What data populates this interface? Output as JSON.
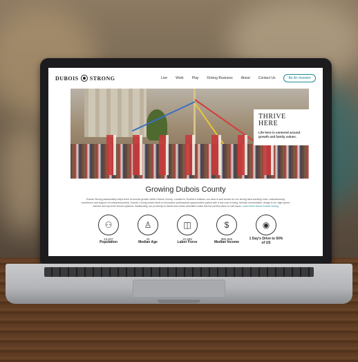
{
  "site": {
    "logo_text_left": "DUBOIS",
    "logo_text_right": "STRONG",
    "nav": [
      "Live",
      "Work",
      "Play",
      "Driving Business",
      "About",
      "Contact Us"
    ],
    "cta": "Be An Investor"
  },
  "hero": {
    "title": "THRIVE HERE",
    "subtitle": "Life here is centered around growth and family values."
  },
  "section": {
    "title": "Growing Dubois County",
    "body": "Dubois Strong passionately helps drive economic growth within Dubois County. Located in Southern Indiana, our area is well known for our strong hard-working roots, manufacturing excellence and support of entrepreneurship. Dubois County prides itself on innovative professional opportunities paired with a low cost of living, friendly communities, things to do, high speed internet and top-level school systems. Additionally, our proximity to transit and urban amenities make this the perfect place to call home.",
    "link": "Learn More About Dubois Strong"
  },
  "stats": [
    {
      "value": "43,637",
      "label": "Population",
      "icon": "people-icon"
    },
    {
      "value": "40",
      "label": "Median Age",
      "icon": "group-icon"
    },
    {
      "value": "22,585",
      "label": "Labor Force",
      "icon": "toolbox-icon"
    },
    {
      "value": "$50,666",
      "label": "Median Income",
      "icon": "money-bag-icon"
    },
    {
      "value": "",
      "label": "1 Day's Drive to 50% of US",
      "icon": "map-pin-icon"
    }
  ],
  "colors": {
    "accent": "#1f8a99",
    "text": "#2b2b2b"
  }
}
